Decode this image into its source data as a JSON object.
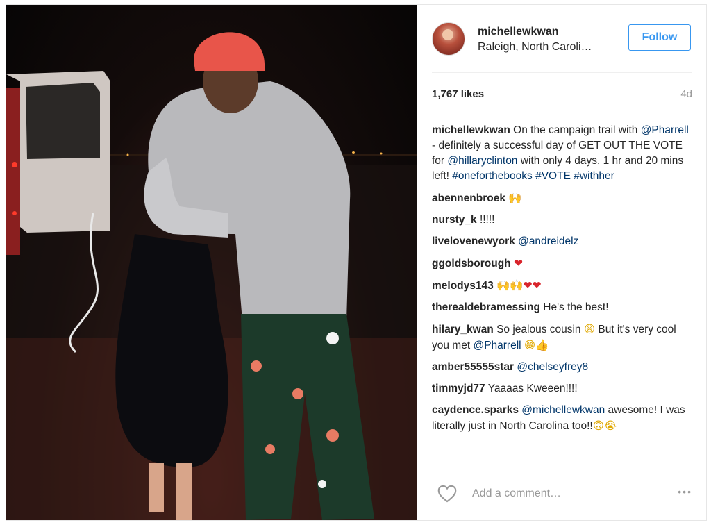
{
  "post": {
    "photo_alt": "",
    "header": {
      "username": "michellewkwan",
      "location": "Raleigh, North Caroli…",
      "follow_label": "Follow"
    },
    "likes": "1,767 likes",
    "time": "4d",
    "caption": {
      "user": "michellewkwan",
      "text_1": "On the campaign trail with",
      "mention_1": "@Pharrell",
      "text_2": " - definitely a successful day of GET OUT THE VOTE for ",
      "mention_2": "@hillaryclinton",
      "text_3": " with only 4 days, 1 hr and 20 mins left! ",
      "hashtags": "#oneforthebooks #VOTE #withher"
    },
    "comments": [
      {
        "user": "abennenbroek",
        "text": "",
        "emoji": "🙌"
      },
      {
        "user": "nursty_k",
        "text": "!!!!!",
        "emoji": ""
      },
      {
        "user": "livelovenewyork",
        "mention": "@andreidelz"
      },
      {
        "user": "ggoldsborough",
        "emoji": "❤"
      },
      {
        "user": "melodys143",
        "emoji": "🙌🙌❤❤"
      },
      {
        "user": "therealdebramessing",
        "text": "He's the best!"
      },
      {
        "user": "hilary_kwan",
        "text_1": "So jealous cousin",
        "emoji_1": "😩",
        "text_2": "But it's very cool you met",
        "mention": "@Pharrell",
        "emoji_2": "😁👍"
      },
      {
        "user": "amber55555star",
        "mention": "@chelseyfrey8"
      },
      {
        "user": "timmyjd77",
        "text": "Yaaaas Kweeen!!!!"
      },
      {
        "user": "caydence.sparks",
        "mention": "@michellewkwan",
        "text": "awesome! I was literally just in North Carolina too!!",
        "emoji": "🙃😭"
      }
    ],
    "footer": {
      "comment_placeholder": "Add a comment…",
      "more_label": "•••"
    }
  },
  "colors": {
    "follow_blue": "#3897f0",
    "link": "#003569",
    "muted": "#999999"
  }
}
